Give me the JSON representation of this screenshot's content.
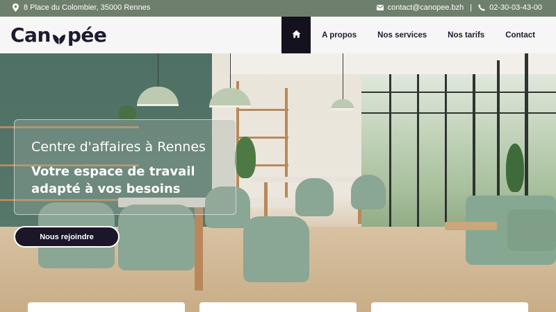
{
  "topbar": {
    "address": "8 Place du Colombier, 35000 Rennes",
    "email": "contact@canopee.bzh",
    "separator": "|",
    "phone": "02-30-03-43-00",
    "icons": {
      "address": "map-pin-icon",
      "email": "envelope-icon",
      "phone": "phone-icon"
    },
    "background_color": "#6f7f6d"
  },
  "header": {
    "logo_text_start": "Can",
    "logo_text_end": "pée",
    "nav": {
      "home_icon": "home-icon",
      "items": [
        {
          "label": "A propos"
        },
        {
          "label": "Nos services"
        },
        {
          "label": "Nos tarifs"
        },
        {
          "label": "Contact"
        }
      ]
    },
    "accent_color": "#14121e"
  },
  "hero": {
    "subtitle": "Centre d'affaires à Rennes",
    "title": "Votre espace de travail adapté à vos besoins",
    "cta_label": "Nous rejoindre"
  }
}
